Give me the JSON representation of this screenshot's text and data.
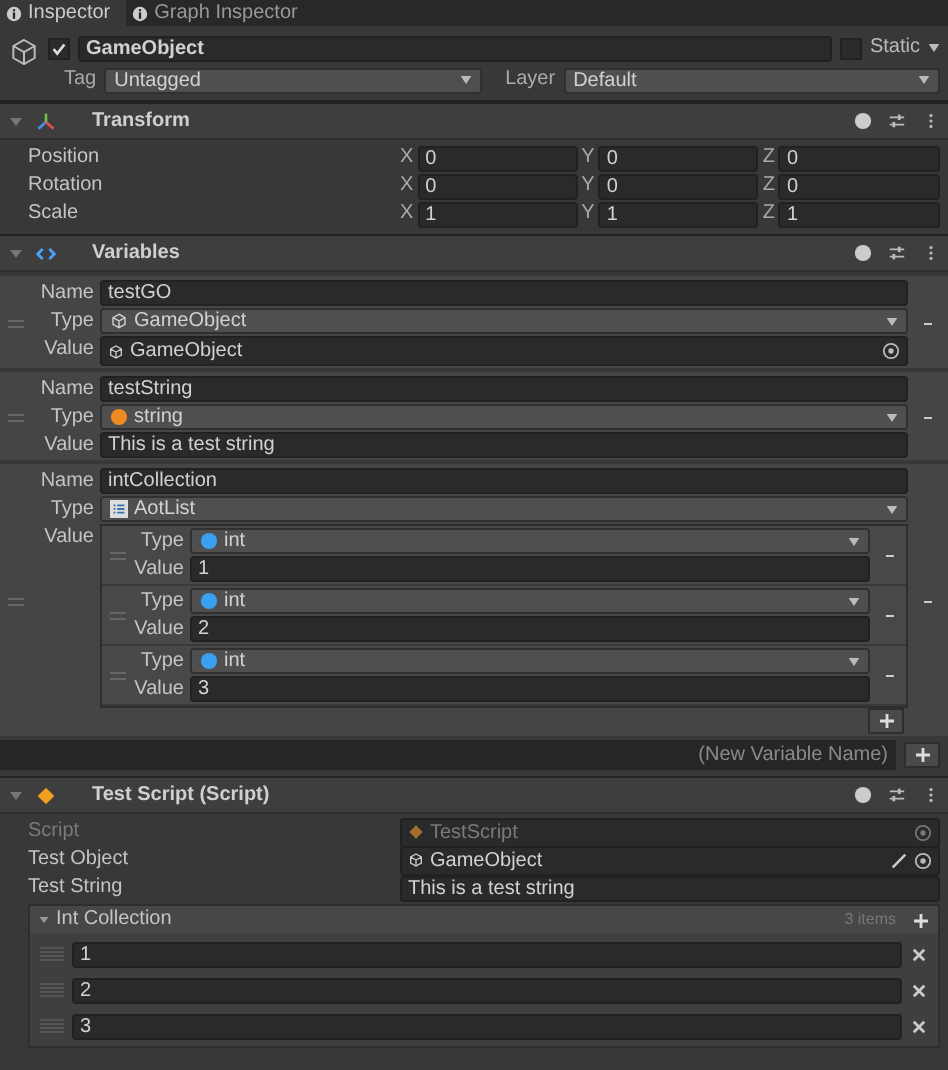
{
  "tabs": [
    {
      "label": "Inspector",
      "selected": true
    },
    {
      "label": "Graph Inspector",
      "selected": false
    }
  ],
  "game_object": {
    "active": true,
    "name": "GameObject",
    "static": false,
    "static_label": "Static",
    "tag_label": "Tag",
    "tag": "Untagged",
    "layer_label": "Layer",
    "layer": "Default"
  },
  "transform": {
    "title": "Transform",
    "expanded": true,
    "fields": [
      {
        "label": "Position",
        "axes": [
          {
            "axis": "X",
            "value": "0"
          },
          {
            "axis": "Y",
            "value": "0"
          },
          {
            "axis": "Z",
            "value": "0"
          }
        ]
      },
      {
        "label": "Rotation",
        "axes": [
          {
            "axis": "X",
            "value": "0"
          },
          {
            "axis": "Y",
            "value": "0"
          },
          {
            "axis": "Z",
            "value": "0"
          }
        ]
      },
      {
        "label": "Scale",
        "axes": [
          {
            "axis": "X",
            "value": "1"
          },
          {
            "axis": "Y",
            "value": "1"
          },
          {
            "axis": "Z",
            "value": "1"
          }
        ]
      }
    ]
  },
  "variables": {
    "title": "Variables",
    "expanded": true,
    "new_variable_placeholder": "(New Variable Name)",
    "items": [
      {
        "kind": "object",
        "name_label": "Name",
        "name": "testGO",
        "type_label": "Type",
        "type": {
          "kind": "cube",
          "label": "GameObject"
        },
        "value_label": "Value",
        "value": "GameObject"
      },
      {
        "kind": "text",
        "name_label": "Name",
        "name": "testString",
        "type_label": "Type",
        "type": {
          "kind": "string",
          "label": "string"
        },
        "value_label": "Value",
        "value": "This is a test string"
      },
      {
        "kind": "list",
        "name_label": "Name",
        "name": "intCollection",
        "type_label": "Type",
        "type": {
          "kind": "list",
          "label": "AotList"
        },
        "value_label": "Value",
        "items": [
          {
            "type_label": "Type",
            "type": {
              "kind": "int",
              "label": "int"
            },
            "value_label": "Value",
            "value": "1"
          },
          {
            "type_label": "Type",
            "type": {
              "kind": "int",
              "label": "int"
            },
            "value_label": "Value",
            "value": "2"
          },
          {
            "type_label": "Type",
            "type": {
              "kind": "int",
              "label": "int"
            },
            "value_label": "Value",
            "value": "3"
          }
        ]
      }
    ]
  },
  "script": {
    "title": "Test Script (Script)",
    "expanded": true,
    "script_label": "Script",
    "script": "TestScript",
    "fields": [
      {
        "kind": "object",
        "label": "Test Object",
        "value": "GameObject"
      },
      {
        "kind": "text",
        "label": "Test String",
        "value": "This is a test string"
      }
    ],
    "list": {
      "title": "Int Collection",
      "expanded": true,
      "count": "3 items",
      "items": [
        "1",
        "2",
        "3"
      ]
    }
  }
}
